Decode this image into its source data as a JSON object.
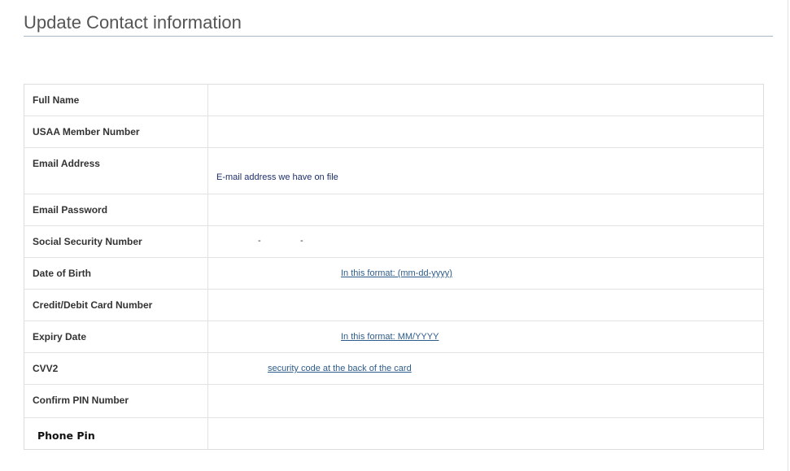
{
  "page": {
    "title": "Update Contact information"
  },
  "form": {
    "full_name": {
      "label": "Full Name"
    },
    "member_number": {
      "label": "USAA Member Number"
    },
    "email_address": {
      "label": "Email Address",
      "hint": "E-mail address we have on file"
    },
    "email_password": {
      "label": "Email Password"
    },
    "ssn": {
      "label": "Social Security Number",
      "separator_1": "-",
      "separator_2": "-"
    },
    "dob": {
      "label": "Date of Birth",
      "hint": "In this format: (mm-dd-yyyy)"
    },
    "card_number": {
      "label": "Credit/Debit Card Number"
    },
    "expiry": {
      "label": "Expiry Date",
      "hint": "In this format: MM/YYYY"
    },
    "cvv2": {
      "label": "CVV2",
      "hint": "security code at the back of the card"
    },
    "confirm_pin": {
      "label": "Confirm PIN Number"
    },
    "phone_pin": {
      "label": "Phone Pin"
    }
  }
}
